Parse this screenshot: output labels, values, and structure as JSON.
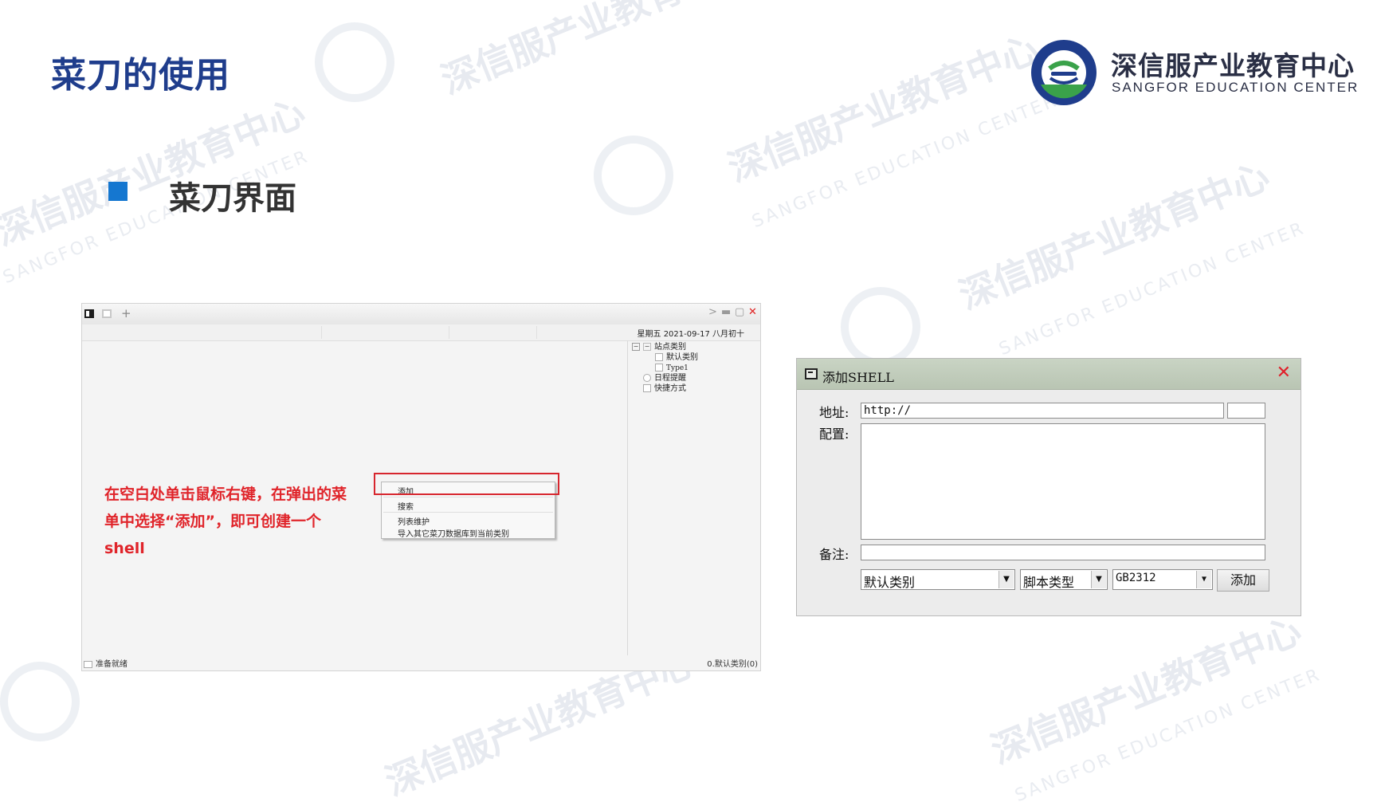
{
  "page": {
    "title": "菜刀的使用",
    "section_title": "菜刀界面",
    "instruction": "在空白处单击鼠标右键，在弹出的菜单中选择“添加”，即可创建一个shell"
  },
  "brand": {
    "name_cn": "深信服产业教育中心",
    "name_en": "SANGFOR EDUCATION CENTER",
    "colors": {
      "blue": "#1f3d8c",
      "green": "#3aa24a",
      "accent_blue": "#1577d0",
      "red": "#e0242a"
    }
  },
  "watermark": {
    "cn": "深信服产业教育中心",
    "en": "SANGFOR EDUCATION CENTER"
  },
  "chopper_window": {
    "date_label": "星期五 2021-09-17 八月初十",
    "tree": [
      "站点类别",
      "默认类别",
      "Type1",
      "日程提醒",
      "快捷方式"
    ],
    "tree_icons": [
      "minus-box-icon",
      "blank-box-icon",
      "blank-box-icon",
      "clock-icon",
      "page-icon"
    ],
    "context_menu": [
      "添加",
      "搜索",
      "列表维护",
      "导入其它菜刀数据库到当前类别"
    ],
    "status_left": "准备就绪",
    "status_right": "0.默认类别(0)"
  },
  "add_shell_dialog": {
    "title": "添加SHELL",
    "address_label": "地址:",
    "address_value": "http://",
    "config_label": "配置:",
    "note_label": "备注:",
    "category_select": "默认类别",
    "script_type_select": "脚本类型",
    "encoding_select": "GB2312",
    "add_button": "添加"
  }
}
